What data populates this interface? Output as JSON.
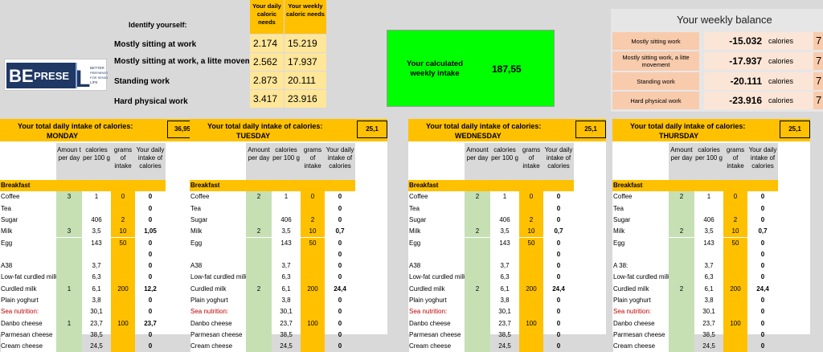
{
  "header": {
    "identify_label": "Identify yourself:",
    "work_types": [
      "Mostly sitting at work",
      "Mostly sitting at work, a litte moveme",
      "Standing work",
      "Hard physical work"
    ],
    "daily_needs_header": "Your daily caloric needs",
    "weekly_needs_header": "Your weekly caloric needs",
    "daily_needs": [
      "2.174",
      "2.562",
      "2.873",
      "3.417"
    ],
    "weekly_needs": [
      "15.219",
      "17.937",
      "20.111",
      "23.916"
    ]
  },
  "intake": {
    "label": "Your calculated weekly intake",
    "value": "187,55",
    "color": "#00ff00"
  },
  "weekly_balance": {
    "title": "Your weekly balance",
    "unit": "calories",
    "rows": [
      {
        "label": "Mostly sitting work",
        "value": "-15.032",
        "extra": "7"
      },
      {
        "label": "Mostly sitting work, a litte movement",
        "value": "-17.937",
        "extra": "7"
      },
      {
        "label": "Standing work",
        "value": "-20.111",
        "extra": "7"
      },
      {
        "label": "Hard physical work",
        "value": "-23.916",
        "extra": "7"
      }
    ]
  },
  "logo": {
    "letters": "BEPRESEL",
    "tagline": [
      "BETTER",
      "PREPARATION",
      "FOR SENIOR",
      "LIFE"
    ]
  },
  "colors": {
    "accent": "#ffc000",
    "accent_light": "#ffe699",
    "amount_col": "#c6e0b4",
    "balance_label": "#f8cbad",
    "balance_value": "#fbe5d6",
    "red_text": "#c00000"
  },
  "day_header_label": "Your total daily intake of calories:",
  "columns": {
    "amount": "Amount per day",
    "amount_monday": "Amoun t per day",
    "cal_per_100g": "calories per 100 g",
    "grams": "grams of intake",
    "daily": "Your daily intake of calories"
  },
  "days": [
    {
      "name": "MONDAY",
      "total": "36,95",
      "rows": [
        {
          "name": "Breakfast",
          "section": true
        },
        {
          "name": "Coffee",
          "amount": "3",
          "cal": "1",
          "grams": "0",
          "daily": "0"
        },
        {
          "name": "Tea",
          "amount": "",
          "cal": "",
          "grams": "",
          "daily": "0"
        },
        {
          "name": "Sugar",
          "amount": "",
          "cal": "406",
          "grams": "2",
          "daily": "0"
        },
        {
          "name": "Milk",
          "amount": "3",
          "cal": "3,5",
          "grams": "10",
          "daily": "1,05"
        },
        {
          "name": "Egg",
          "amount": "",
          "cal": "143",
          "grams": "50",
          "daily": "0"
        },
        {
          "name": "",
          "amount": "",
          "cal": "",
          "grams": "",
          "daily": "0"
        },
        {
          "name": "A38",
          "amount": "",
          "cal": "3,7",
          "grams": "",
          "daily": "0"
        },
        {
          "name": "Low-fat curdled milk",
          "amount": "",
          "cal": "6,3",
          "grams": "",
          "daily": "0"
        },
        {
          "name": "Curdled milk",
          "amount": "1",
          "cal": "6,1",
          "grams": "200",
          "daily": "12,2"
        },
        {
          "name": "Plain yoghurt",
          "amount": "",
          "cal": "3,8",
          "grams": "",
          "daily": "0"
        },
        {
          "name": "Sea nutrition:",
          "red": true,
          "amount": "",
          "cal": "30,1",
          "grams": "",
          "daily": "0"
        },
        {
          "name": "Danbo cheese",
          "amount": "1",
          "cal": "23,7",
          "grams": "100",
          "daily": "23,7"
        },
        {
          "name": "Parmesan cheese",
          "amount": "",
          "cal": "38,5",
          "grams": "",
          "daily": "0"
        },
        {
          "name": "Cream cheese",
          "amount": "",
          "cal": "24,5",
          "grams": "",
          "daily": "0"
        }
      ]
    },
    {
      "name": "TUESDAY",
      "total": "25,1",
      "rows": [
        {
          "name": "Breakfast",
          "section": true
        },
        {
          "name": "Coffee",
          "amount": "2",
          "cal": "1",
          "grams": "0",
          "daily": "0"
        },
        {
          "name": "Tea",
          "amount": "",
          "cal": "",
          "grams": "",
          "daily": "0"
        },
        {
          "name": "Sugar",
          "amount": "",
          "cal": "406",
          "grams": "2",
          "daily": "0"
        },
        {
          "name": "Milk",
          "amount": "2",
          "cal": "3,5",
          "grams": "10",
          "daily": "0,7"
        },
        {
          "name": "Egg",
          "amount": "",
          "cal": "143",
          "grams": "50",
          "daily": "0"
        },
        {
          "name": "",
          "amount": "",
          "cal": "",
          "grams": "",
          "daily": "0"
        },
        {
          "name": "A38",
          "amount": "",
          "cal": "3,7",
          "grams": "",
          "daily": "0"
        },
        {
          "name": "Low-fat curdled milk",
          "amount": "",
          "cal": "6,3",
          "grams": "",
          "daily": "0"
        },
        {
          "name": "Curdled milk",
          "amount": "2",
          "cal": "6,1",
          "grams": "200",
          "daily": "24,4"
        },
        {
          "name": "Plain yoghurt",
          "amount": "",
          "cal": "3,8",
          "grams": "",
          "daily": "0"
        },
        {
          "name": "Sea nutrition:",
          "red": true,
          "amount": "",
          "cal": "30,1",
          "grams": "",
          "daily": "0"
        },
        {
          "name": "Danbo cheese",
          "amount": "",
          "cal": "23,7",
          "grams": "100",
          "daily": "0"
        },
        {
          "name": "Parmesan cheese",
          "amount": "",
          "cal": "38,5",
          "grams": "",
          "daily": "0"
        },
        {
          "name": "Cream cheese",
          "amount": "",
          "cal": "24,5",
          "grams": "",
          "daily": "0"
        }
      ]
    },
    {
      "name": "WEDNESDAY",
      "total": "25,1",
      "rows": [
        {
          "name": "Breakfast",
          "section": true
        },
        {
          "name": "Coffee",
          "amount": "2",
          "cal": "1",
          "grams": "0",
          "daily": "0"
        },
        {
          "name": "Tea",
          "amount": "",
          "cal": "",
          "grams": "",
          "daily": "0"
        },
        {
          "name": "Sugar",
          "amount": "",
          "cal": "406",
          "grams": "2",
          "daily": "0"
        },
        {
          "name": "Milk",
          "amount": "2",
          "cal": "3,5",
          "grams": "10",
          "daily": "0,7"
        },
        {
          "name": "Egg",
          "amount": "",
          "cal": "143",
          "grams": "50",
          "daily": "0"
        },
        {
          "name": "",
          "amount": "",
          "cal": "",
          "grams": "",
          "daily": "0"
        },
        {
          "name": "A38",
          "amount": "",
          "cal": "3,7",
          "grams": "",
          "daily": "0"
        },
        {
          "name": "Low-fat curdled milk",
          "amount": "",
          "cal": "6,3",
          "grams": "",
          "daily": "0"
        },
        {
          "name": "Curdled milk",
          "amount": "2",
          "cal": "6,1",
          "grams": "200",
          "daily": "24,4"
        },
        {
          "name": "Plain yoghurt",
          "amount": "",
          "cal": "3,8",
          "grams": "",
          "daily": "0"
        },
        {
          "name": "Sea nutrition:",
          "red": true,
          "amount": "",
          "cal": "30,1",
          "grams": "",
          "daily": "0"
        },
        {
          "name": "Danbo cheese",
          "amount": "",
          "cal": "23,7",
          "grams": "100",
          "daily": "0"
        },
        {
          "name": "Parmesan cheese",
          "amount": "",
          "cal": "38,5",
          "grams": "",
          "daily": "0"
        },
        {
          "name": "Cream cheese",
          "amount": "",
          "cal": "24,5",
          "grams": "",
          "daily": "0"
        }
      ]
    },
    {
      "name": "THURSDAY",
      "total": "25,1",
      "rows": [
        {
          "name": "Breakfast",
          "section": true
        },
        {
          "name": "Coffee",
          "amount": "2",
          "cal": "1",
          "grams": "0",
          "daily": "0"
        },
        {
          "name": "Tea",
          "amount": "",
          "cal": "",
          "grams": "",
          "daily": "0"
        },
        {
          "name": "Sugar",
          "amount": "",
          "cal": "406",
          "grams": "2",
          "daily": "0"
        },
        {
          "name": "Milk",
          "amount": "2",
          "cal": "3,5",
          "grams": "10",
          "daily": "0,7"
        },
        {
          "name": "Egg",
          "amount": "",
          "cal": "143",
          "grams": "50",
          "daily": "0"
        },
        {
          "name": "",
          "amount": "",
          "cal": "",
          "grams": "",
          "daily": "0"
        },
        {
          "name": "A 38:",
          "amount": "",
          "cal": "3,7",
          "grams": "",
          "daily": "0"
        },
        {
          "name": "Low-fat curdled milk",
          "amount": "",
          "cal": "6,3",
          "grams": "",
          "daily": "0"
        },
        {
          "name": "Curdled milk",
          "amount": "2",
          "cal": "6,1",
          "grams": "200",
          "daily": "24,4"
        },
        {
          "name": "Plain yoghurt",
          "amount": "",
          "cal": "3,8",
          "grams": "",
          "daily": "0"
        },
        {
          "name": "Sea nutrition:",
          "red": true,
          "amount": "",
          "cal": "30,1",
          "grams": "",
          "daily": "0"
        },
        {
          "name": "Danbo cheese",
          "amount": "",
          "cal": "23,7",
          "grams": "100",
          "daily": "0"
        },
        {
          "name": "Parmesan cheese",
          "amount": "",
          "cal": "38,5",
          "grams": "",
          "daily": "0"
        },
        {
          "name": "Cream cheese",
          "amount": "",
          "cal": "24,5",
          "grams": "",
          "daily": "0"
        }
      ]
    }
  ]
}
